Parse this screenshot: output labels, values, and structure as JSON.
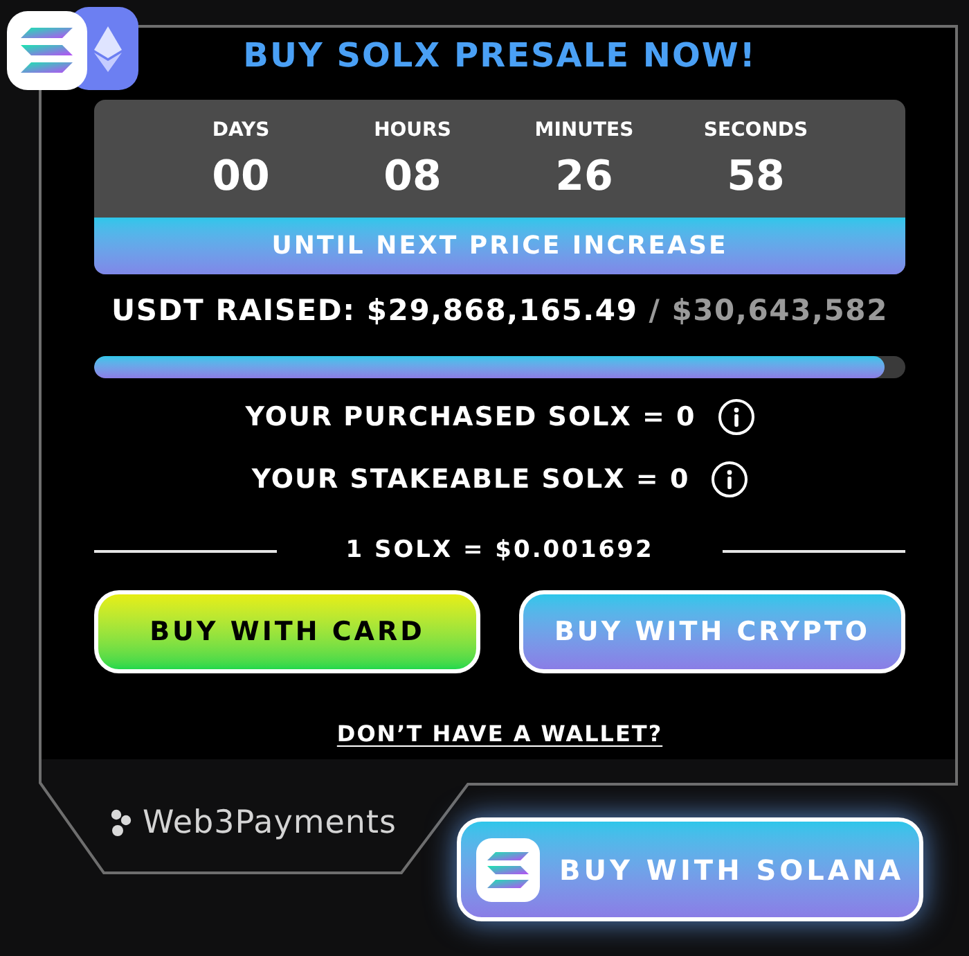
{
  "title": "BUY SOLX PRESALE NOW!",
  "countdown": {
    "units": [
      {
        "label": "DAYS",
        "value": "00"
      },
      {
        "label": "HOURS",
        "value": "08"
      },
      {
        "label": "MINUTES",
        "value": "26"
      },
      {
        "label": "SECONDS",
        "value": "58"
      }
    ],
    "caption": "UNTIL NEXT PRICE INCREASE"
  },
  "raised": {
    "label": "USDT RAISED:",
    "amount": "$29,868,165.49",
    "separator": "/",
    "target": "$30,643,582"
  },
  "progress": {
    "level": 0.975
  },
  "balances": [
    {
      "text": "YOUR PURCHASED SOLX = 0"
    },
    {
      "text": "YOUR STAKEABLE SOLX = 0"
    }
  ],
  "price": "1 SOLX = $0.001692",
  "buttons": [
    {
      "kind": "card",
      "label": "BUY WITH CARD"
    },
    {
      "kind": "crypto",
      "label": "BUY WITH CRYPTO"
    }
  ],
  "wallet_link": "DON’T HAVE A WALLET?",
  "footer": {
    "brand": "Web3Payments",
    "solana_button": "BUY WITH SOLANA"
  }
}
